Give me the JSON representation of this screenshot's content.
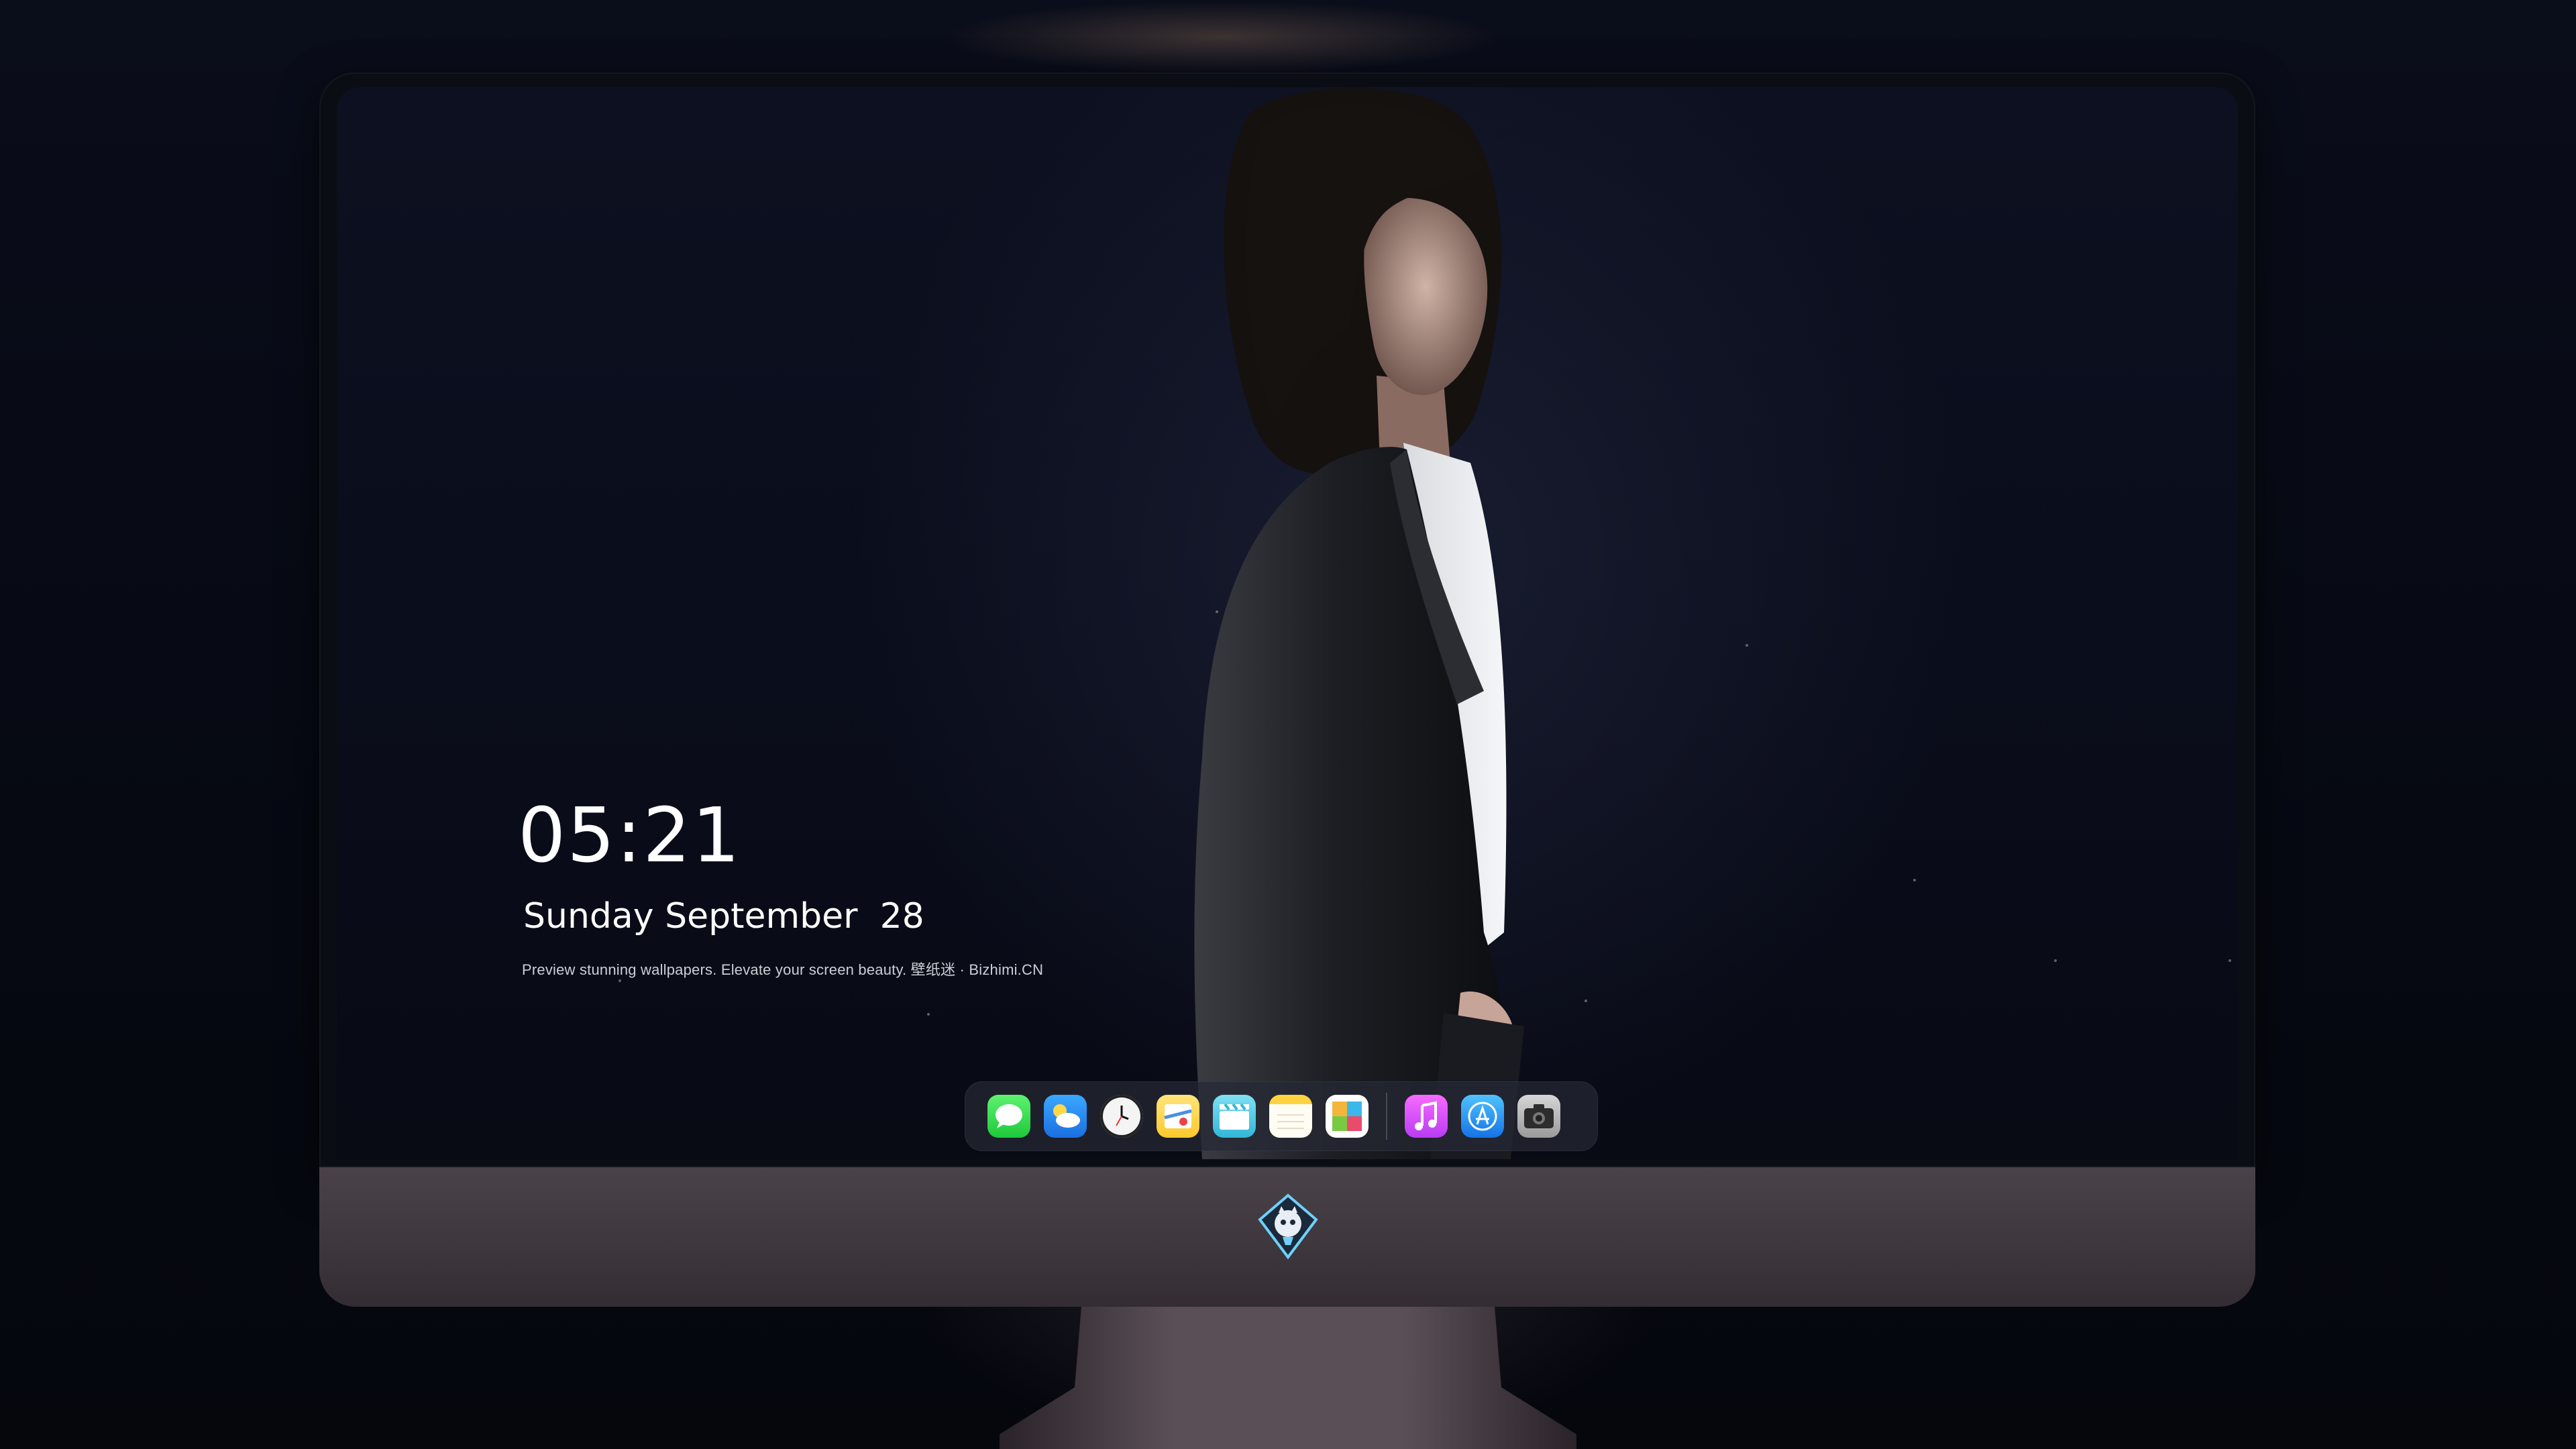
{
  "lockscreen": {
    "time": "05:21",
    "date": "Sunday September  28",
    "tagline": "Preview stunning wallpapers. Elevate your screen beauty. 壁纸迷 · Bizhimi.CN"
  },
  "dock": {
    "apps": [
      {
        "name": "messages",
        "icon": "messages-icon"
      },
      {
        "name": "weather",
        "icon": "weather-icon"
      },
      {
        "name": "clock",
        "icon": "clock-icon"
      },
      {
        "name": "maps",
        "icon": "maps-icon"
      },
      {
        "name": "clips",
        "icon": "clapperboard-icon"
      },
      {
        "name": "notes",
        "icon": "notes-icon"
      },
      {
        "name": "photos",
        "icon": "photos-icon"
      },
      {
        "name": "music",
        "icon": "music-note-icon"
      },
      {
        "name": "app-store",
        "icon": "app-store-icon"
      },
      {
        "name": "camera",
        "icon": "camera-icon"
      }
    ]
  },
  "monitor": {
    "chin_logo": "mascot-logo-icon"
  },
  "colors": {
    "background": "#070a14",
    "chin": "#433b42",
    "text": "#ffffff"
  }
}
